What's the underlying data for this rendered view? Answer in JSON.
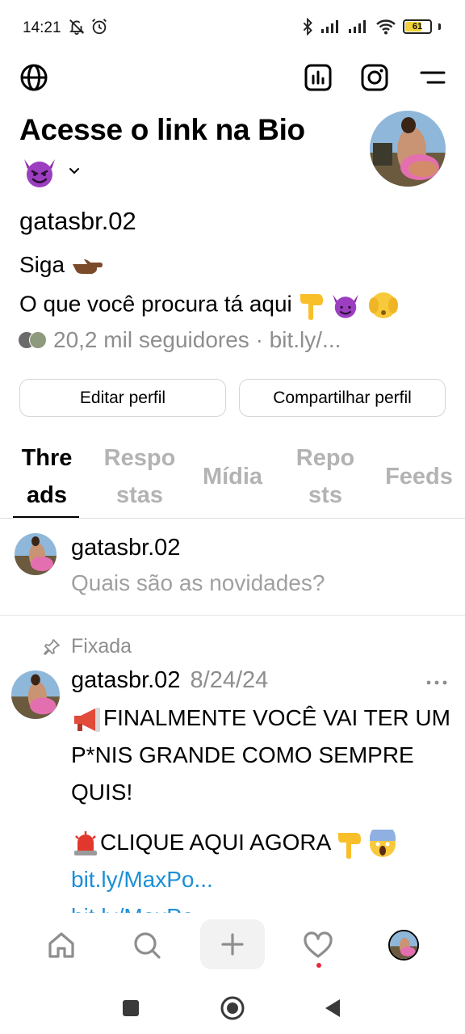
{
  "status_bar": {
    "time": "14:21",
    "battery": "61",
    "icons": [
      "mute-icon",
      "alarm-icon",
      "bluetooth-icon",
      "signal-icon",
      "signal-icon",
      "wifi-icon",
      "battery-icon"
    ]
  },
  "top_nav": {
    "icons": [
      "globe-icon",
      "insights-icon",
      "instagram-icon",
      "menu-icon"
    ]
  },
  "profile": {
    "display_name": "Acesse o link na Bio",
    "username": "gatasbr.02",
    "bio_line1": "Siga",
    "bio_line2": "O que você procura tá aqui",
    "followers": "20,2 mil seguidores · bit.ly/...",
    "edit_button": "Editar perfil",
    "share_button": "Compartilhar perfil"
  },
  "tabs": [
    {
      "label": "Threads",
      "active": true
    },
    {
      "label": "Respostas",
      "active": false
    },
    {
      "label": "Mídia",
      "active": false
    },
    {
      "label": "Reposts",
      "active": false
    },
    {
      "label": "Feeds",
      "active": false
    }
  ],
  "composer": {
    "username": "gatasbr.02",
    "prompt": "Quais são as novidades?"
  },
  "post": {
    "pinned_label": "Fixada",
    "username": "gatasbr.02",
    "date": "8/24/24",
    "text1": "FINALMENTE VOCÊ VAI TER UM P*NIS GRANDE COMO SEMPRE QUIS!",
    "text2": "CLIQUE AQUI AGORA",
    "link": "bit.ly/MaxPo...",
    "link_cut": "bit.ly/MaxPo..."
  },
  "bottom_nav": {
    "icons": [
      "home-icon",
      "search-icon",
      "plus-icon",
      "heart-icon",
      "profile-avatar"
    ]
  },
  "colors": {
    "link": "#1b8fd6",
    "muted": "#8e8e8e",
    "notification": "#e6283c",
    "battery": "#f2d13a"
  }
}
